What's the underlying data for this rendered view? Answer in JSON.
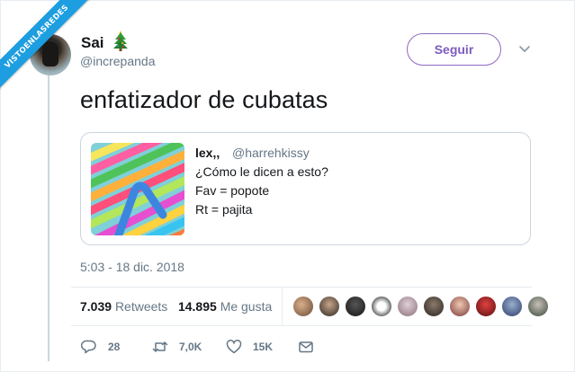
{
  "watermark": "VISTOENLASREDES",
  "author": {
    "display_name": "Sai",
    "name_emoji": "christmas-tree-icon",
    "handle": "@increpanda"
  },
  "follow_button": {
    "label": "Seguir",
    "color": "#7d5bbf"
  },
  "tweet": {
    "text": "enfatizador de cubatas",
    "timestamp": "5:03 - 18 dic. 2018"
  },
  "quoted_tweet": {
    "name": "lex,,",
    "handle": "@harrehkissy",
    "lines": [
      "¿Cómo le dicen a esto?",
      "Fav = popote",
      "Rt = pajita"
    ],
    "image": "colorful-straws"
  },
  "stats": {
    "retweets_count": "7.039",
    "retweets_label": "Retweets",
    "likes_count": "14.895",
    "likes_label": "Me gusta"
  },
  "actions": {
    "reply_count": "28",
    "retweet_count": "7,0K",
    "like_count": "15K"
  },
  "colors": {
    "accent": "#7d5bbf",
    "thread_line": "#ccd6dd",
    "muted_text": "#657786",
    "watermark_ribbon": "#1d9ee0"
  }
}
